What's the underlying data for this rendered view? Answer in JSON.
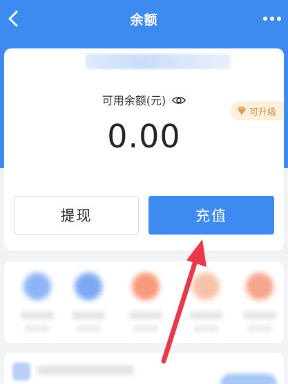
{
  "header": {
    "title": "余额",
    "back_icon": "chevron-left-icon",
    "more_icon": "more-dots-icon"
  },
  "balance": {
    "label": "可用余额(元)",
    "amount": "0.00",
    "upgrade_badge": "可升级"
  },
  "actions": {
    "withdraw_label": "提现",
    "recharge_label": "充值"
  },
  "colors": {
    "primary": "#3d8bf0",
    "badge_bg": "#fdf1dd",
    "badge_text": "#c9924a",
    "annotation_arrow": "#e8384a"
  },
  "shortcut_icon_colors": [
    "#8fb4f6",
    "#7fa8f3",
    "#f79a7a",
    "#f7c2a9",
    "#f6a68f"
  ]
}
